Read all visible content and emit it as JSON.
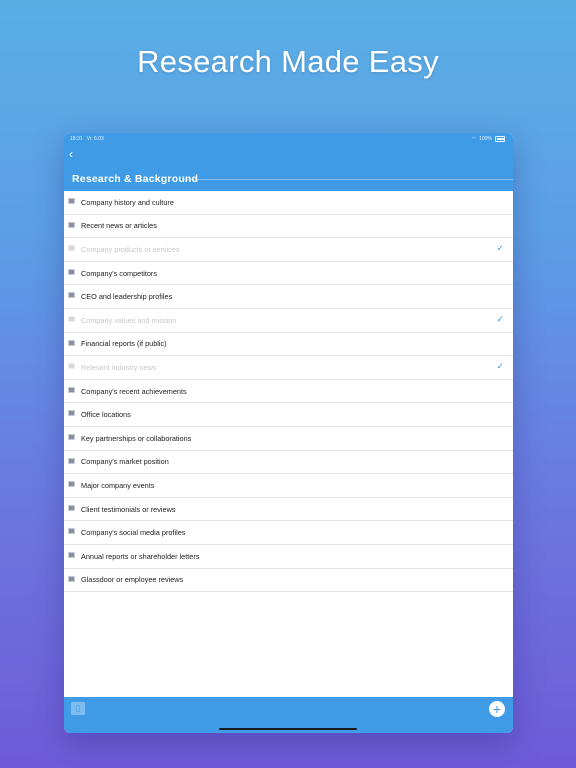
{
  "headline": "Research Made Easy",
  "statusbar": {
    "time": "18:31",
    "date": "Vr. 6.03",
    "battery": "100%"
  },
  "header": {
    "back_icon": "chevron-left-icon",
    "title": "Research & Background"
  },
  "items": [
    {
      "label": "Company history and culture",
      "done": false
    },
    {
      "label": "Recent news or articles",
      "done": false
    },
    {
      "label": "Company products or services",
      "done": true
    },
    {
      "label": "Company's competitors",
      "done": false
    },
    {
      "label": "CEO and leadership profiles",
      "done": false
    },
    {
      "label": "Company values and mission",
      "done": true
    },
    {
      "label": "Financial reports (if public)",
      "done": false
    },
    {
      "label": "Relevant industry news",
      "done": true
    },
    {
      "label": "Company's recent achievements",
      "done": false
    },
    {
      "label": "Office locations",
      "done": false
    },
    {
      "label": "Key partnerships or collaborations",
      "done": false
    },
    {
      "label": "Company's market position",
      "done": false
    },
    {
      "label": "Major company events",
      "done": false
    },
    {
      "label": "Client testimonials or reviews",
      "done": false
    },
    {
      "label": "Company's social media profiles",
      "done": false
    },
    {
      "label": "Annual reports or shareholder letters",
      "done": false
    },
    {
      "label": "Glassdoor or employee reviews",
      "done": false
    }
  ],
  "footer": {
    "book_icon": "book-icon",
    "add_icon": "plus-circle-icon"
  },
  "colors": {
    "accent": "#3f9be6",
    "done_text": "#c7c7cc"
  }
}
